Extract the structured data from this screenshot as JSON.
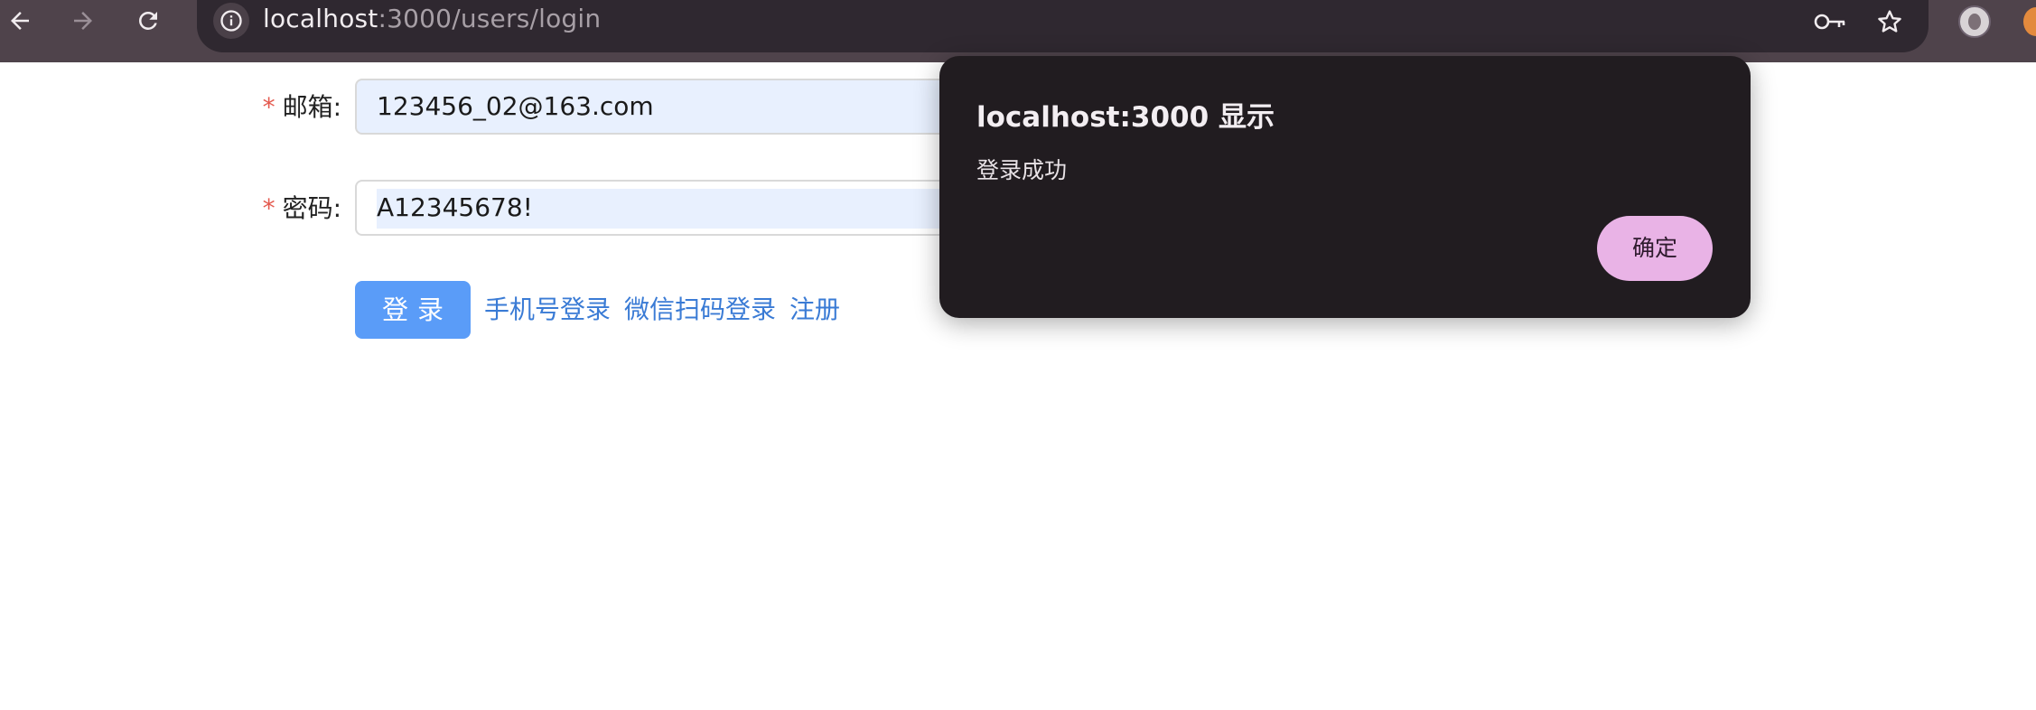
{
  "browser": {
    "url_host": "localhost",
    "url_path": ":3000/users/login",
    "icons": [
      "back-icon",
      "forward-icon",
      "reload-icon",
      "site-info-icon",
      "password-key-icon",
      "bookmark-star-icon",
      "profile-avatar-icon",
      "extension-icon"
    ]
  },
  "form": {
    "required_mark": "*",
    "email_label": "邮箱:",
    "email_value": "123456_02@163.com",
    "password_label": "密码:",
    "password_value": "A12345678!",
    "login_button": "登录",
    "phone_login_link": "手机号登录",
    "wechat_login_link": "微信扫码登录",
    "register_link": "注册"
  },
  "dialog": {
    "title": "localhost:3000 显示",
    "message": "登录成功",
    "ok_button": "确定"
  },
  "colors": {
    "toolbar": "#4f434b",
    "omnibox": "#2f2830",
    "autofill": "#e8f0fe",
    "primary_button": "#5a9cf8",
    "link": "#3a7bd5",
    "required": "#e45a4f",
    "dialog_bg": "#211c20",
    "dialog_button": "#e9b3e6"
  }
}
